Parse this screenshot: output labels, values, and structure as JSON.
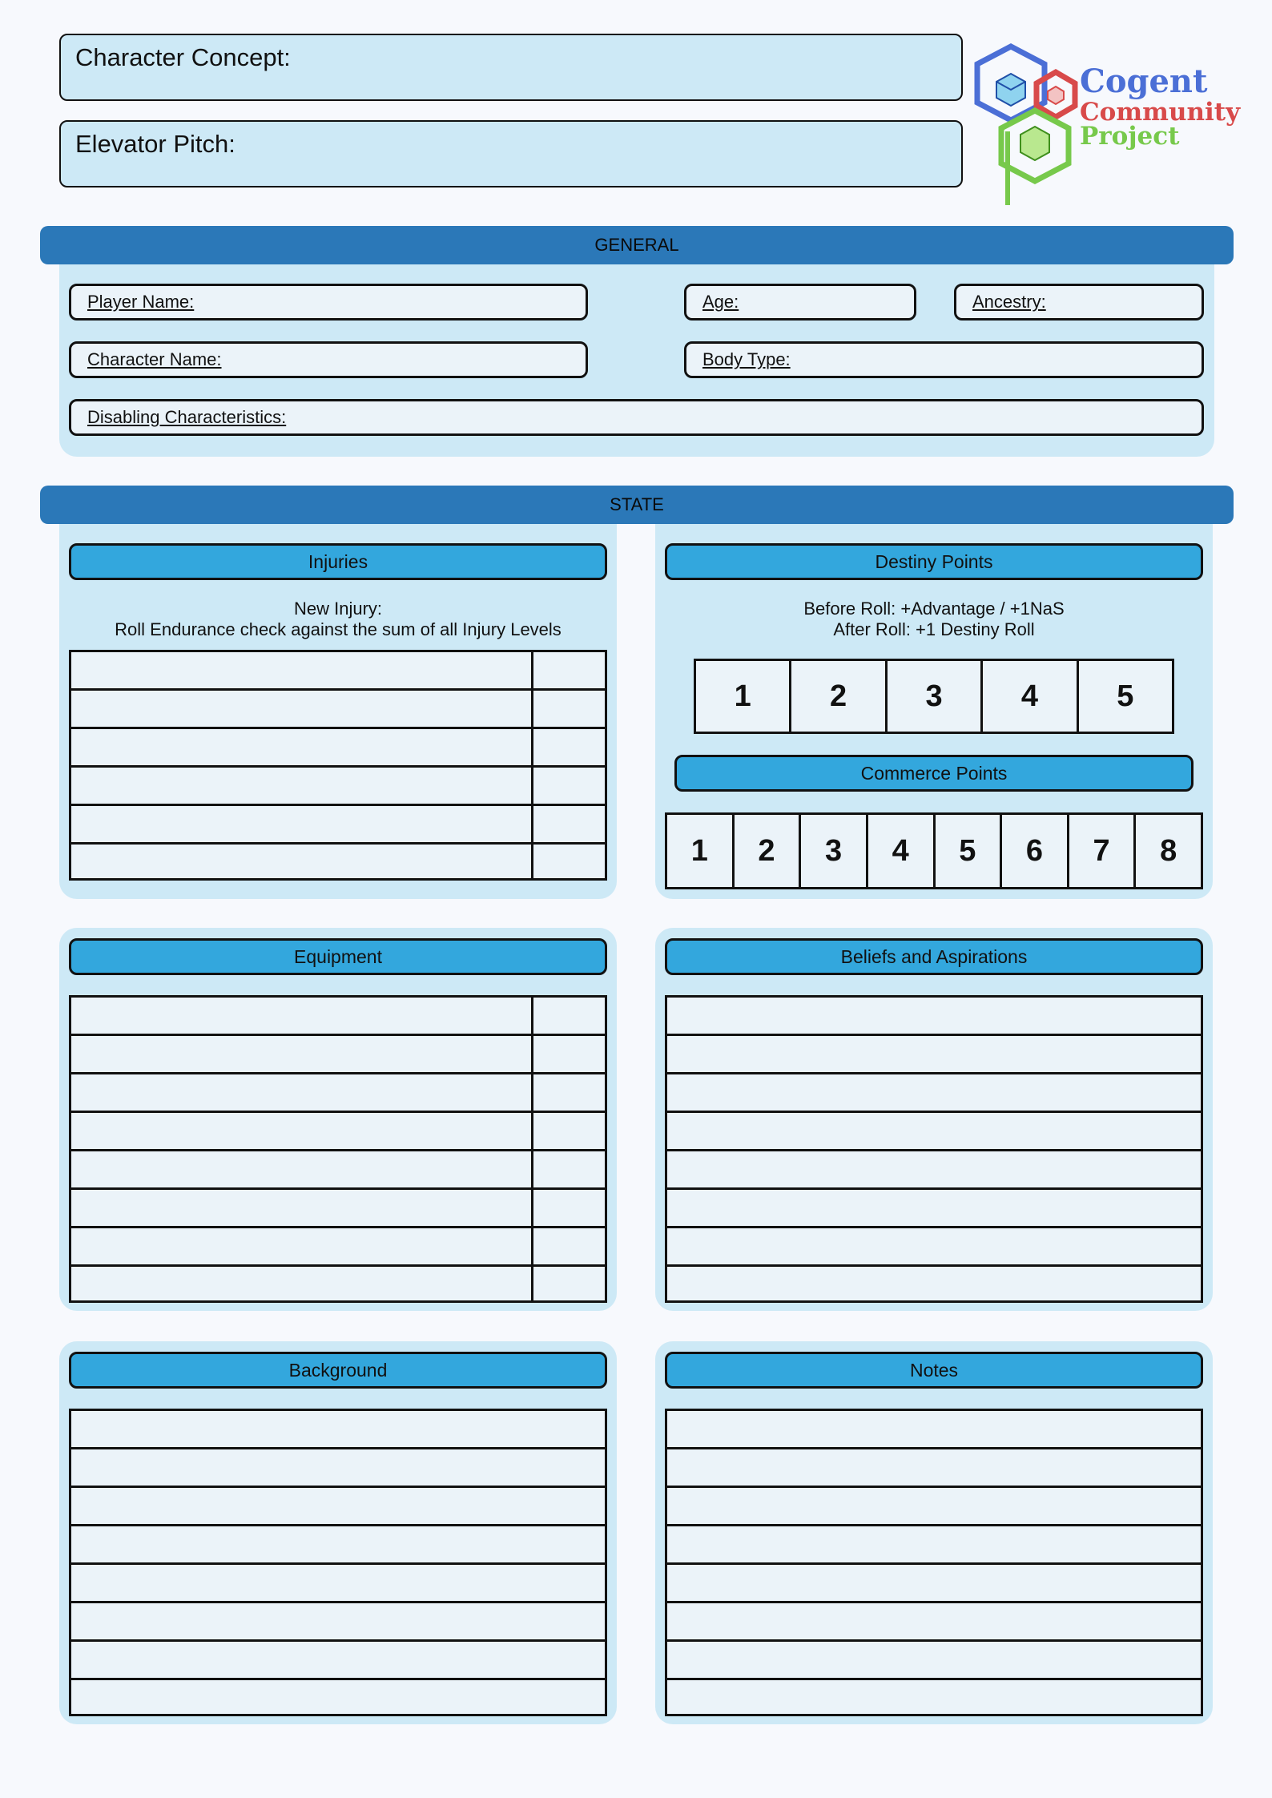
{
  "header": {
    "concept_label": "Character Concept:",
    "pitch_label": "Elevator Pitch:"
  },
  "logo": {
    "line1": "Cogent",
    "line2": "Community",
    "line3": "Project",
    "colors": {
      "blue": "#4b6fd6",
      "red": "#d84a4a",
      "green": "#77c94b"
    }
  },
  "general": {
    "title": "GENERAL",
    "fields": {
      "player_name": "Player Name:",
      "age": "Age:",
      "ancestry": "Ancestry:",
      "character_name": "Character Name:",
      "body_type": "Body Type:",
      "disabling": "Disabling Characteristics:"
    }
  },
  "state": {
    "title": "STATE",
    "injuries": {
      "title": "Injuries",
      "note_line1": "New Injury:",
      "note_line2": "Roll Endurance check against the sum of all Injury Levels"
    },
    "destiny": {
      "title": "Destiny Points",
      "note_line1": "Before Roll: +Advantage / +1NaS",
      "note_line2": "After Roll: +1 Destiny Roll",
      "boxes": [
        "1",
        "2",
        "3",
        "4",
        "5"
      ]
    },
    "commerce": {
      "title": "Commerce Points",
      "boxes": [
        "1",
        "2",
        "3",
        "4",
        "5",
        "6",
        "7",
        "8"
      ]
    }
  },
  "equipment": {
    "title": "Equipment"
  },
  "beliefs": {
    "title": "Beliefs and Aspirations"
  },
  "background": {
    "title": "Background"
  },
  "notes": {
    "title": "Notes"
  },
  "colors": {
    "section_bar": "#2b78b8",
    "pill": "#33a7dd",
    "panel": "#cde9f6",
    "cell": "#ebf3f9"
  }
}
